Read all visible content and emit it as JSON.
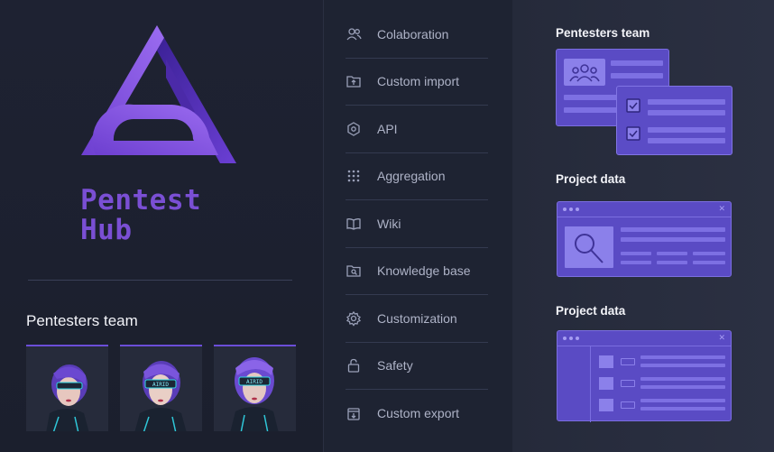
{
  "brand": {
    "name_line1": "Pentest",
    "name_line2": "Hub",
    "accent": "#7a4fd4"
  },
  "left": {
    "team_title": "Pentesters team",
    "avatars": [
      {
        "icon": "avatar-visor-icon"
      },
      {
        "icon": "avatar-visor-icon",
        "visor_text": "AIRID"
      },
      {
        "icon": "avatar-visor-icon",
        "visor_text": "AIRID"
      }
    ]
  },
  "menu": {
    "items": [
      {
        "label": "Colaboration",
        "icon": "people-icon"
      },
      {
        "label": "Custom import",
        "icon": "folder-import-icon"
      },
      {
        "label": "API",
        "icon": "hexagon-icon"
      },
      {
        "label": "Aggregation",
        "icon": "grid-dots-icon"
      },
      {
        "label": "Wiki",
        "icon": "book-icon"
      },
      {
        "label": "Knowledge base",
        "icon": "folder-search-icon"
      },
      {
        "label": "Customization",
        "icon": "gear-icon"
      },
      {
        "label": "Safety",
        "icon": "lock-icon"
      },
      {
        "label": "Custom export",
        "icon": "export-icon"
      }
    ]
  },
  "right": {
    "sections": [
      {
        "title": "Pentesters team"
      },
      {
        "title": "Project data"
      },
      {
        "title": "Project data"
      }
    ],
    "colors": {
      "card": "#5a4bc4",
      "card_border": "#7b6ee0",
      "bar": "#7d70e3"
    }
  }
}
